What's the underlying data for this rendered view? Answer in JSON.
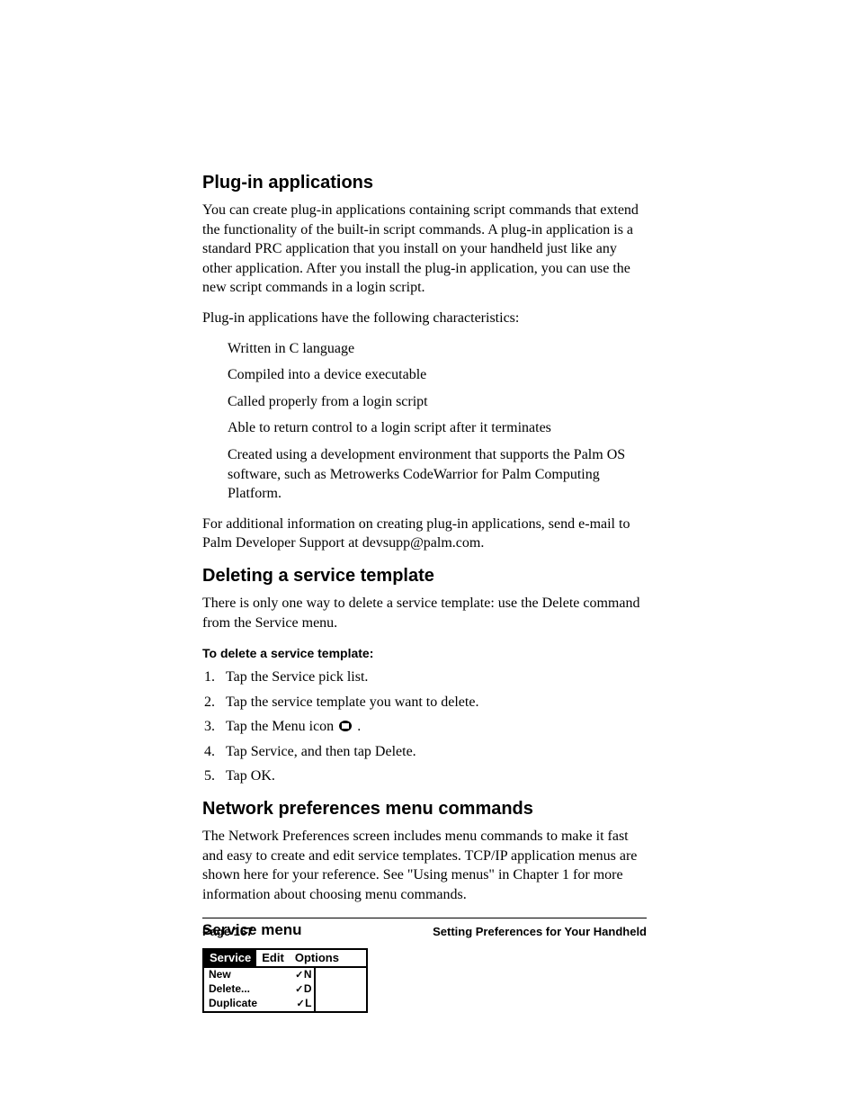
{
  "section1": {
    "heading": "Plug-in applications",
    "para1": "You can create plug-in applications containing script commands that extend the functionality of the built-in script commands. A plug-in application is a standard PRC application that you install on your handheld just like any other application. After you install the plug-in application, you can use the new script commands in a login script.",
    "para2": "Plug-in applications have the following characteristics:",
    "bullets": [
      "Written in C language",
      "Compiled into a device executable",
      "Called properly from a login script",
      "Able to return control to a login script after it terminates",
      "Created using a development environment that supports the Palm OS software, such as Metrowerks CodeWarrior for Palm Computing Platform."
    ],
    "para3": "For additional information on creating plug-in applications, send e-mail to Palm Developer Support at devsupp@palm.com."
  },
  "section2": {
    "heading": "Deleting a service template",
    "para1": "There is only one way to delete a service template: use the Delete command from the Service menu.",
    "proc_title": "To delete a service template:",
    "steps_3_prefix": "Tap the Menu icon ",
    "steps_3_suffix": " .",
    "steps": [
      "Tap the Service pick list.",
      "Tap the service template you want to delete.",
      "__ICON_STEP__",
      "Tap Service, and then tap Delete.",
      "Tap OK."
    ]
  },
  "section3": {
    "heading": "Network preferences menu commands",
    "para1": "The Network Preferences screen includes menu commands to make it fast and easy to create and edit service templates. TCP/IP application menus are shown here for your reference. See \"Using menus\" in Chapter 1 for more information about choosing menu commands.",
    "subheading": "Service menu",
    "menu": {
      "tabs": [
        "Service",
        "Edit",
        "Options"
      ],
      "items": [
        {
          "label": "New",
          "key": "N"
        },
        {
          "label": "Delete...",
          "key": "D"
        },
        {
          "label": "Duplicate",
          "key": "L"
        }
      ]
    }
  },
  "footer": {
    "left": "Page 167",
    "right": "Setting Preferences for Your Handheld"
  }
}
